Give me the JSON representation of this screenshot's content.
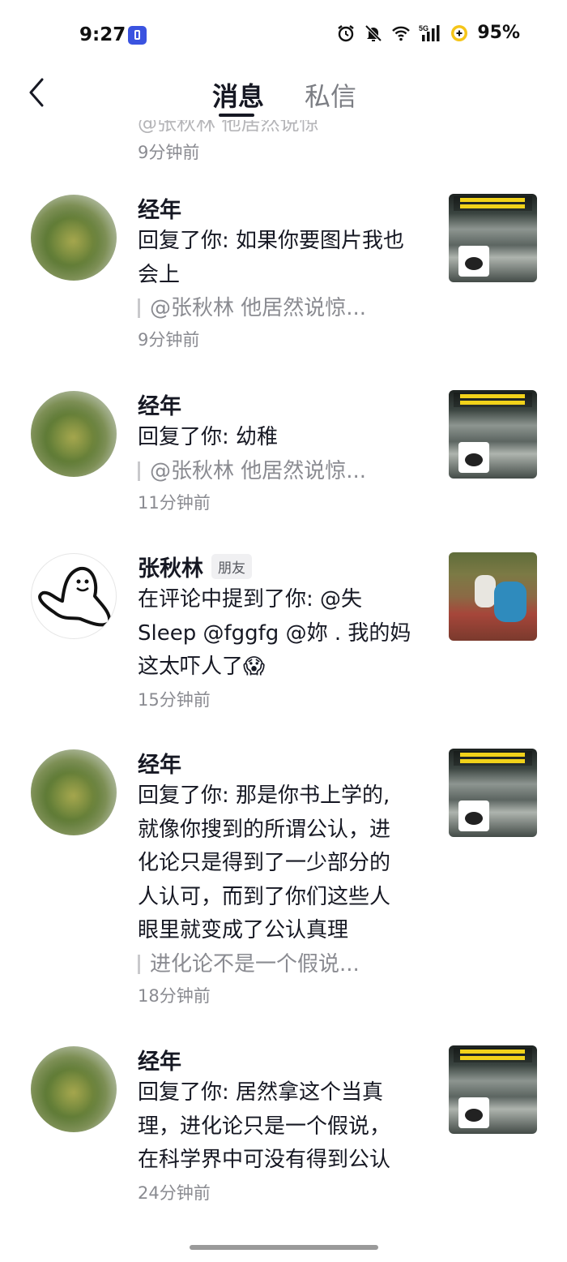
{
  "status_bar": {
    "time": "9:27",
    "battery": "95%",
    "network": "5G",
    "icons": [
      "app-icon",
      "alarm-icon",
      "mute-icon",
      "wifi-icon",
      "signal-icon",
      "battery-saver-icon"
    ]
  },
  "nav": {
    "back_icon": "chevron-left-icon",
    "tabs": [
      {
        "label": "消息",
        "active": true
      },
      {
        "label": "私信",
        "active": false
      }
    ]
  },
  "cut_item": {
    "quote": "@张秋林 他居然说惊",
    "time": "9分钟前"
  },
  "notifications": [
    {
      "name": "经年",
      "badge": "",
      "text": "回复了你: 如果你要图片我也\n会上",
      "quote": "@张秋林 他居然说惊...",
      "time": "9分钟前",
      "avatar": "tree",
      "thumb": "farm"
    },
    {
      "name": "经年",
      "badge": "",
      "text": "回复了你: 幼稚",
      "quote": "@张秋林 他居然说惊...",
      "time": "11分钟前",
      "avatar": "tree",
      "thumb": "farm"
    },
    {
      "name": "张秋林",
      "badge": "朋友",
      "text": "在评论中提到了你: @失\nSleep @fggfg @妳 . 我的妈\n这太吓人了😱",
      "quote": "",
      "time": "15分钟前",
      "avatar": "ghost",
      "thumb": "field"
    },
    {
      "name": "经年",
      "badge": "",
      "text": "回复了你: 那是你书上学的,\n就像你搜到的所谓公认，进\n化论只是得到了一少部分的\n人认可，而到了你们这些人\n眼里就变成了公认真理",
      "quote": "进化论不是一个假说...",
      "time": "18分钟前",
      "avatar": "tree",
      "thumb": "farm"
    },
    {
      "name": "经年",
      "badge": "",
      "text": "回复了你: 居然拿这个当真\n理，进化论只是一个假说，\n在科学界中可没有得到公认",
      "quote": "",
      "time": "24分钟前",
      "avatar": "tree",
      "thumb": "farm"
    }
  ]
}
